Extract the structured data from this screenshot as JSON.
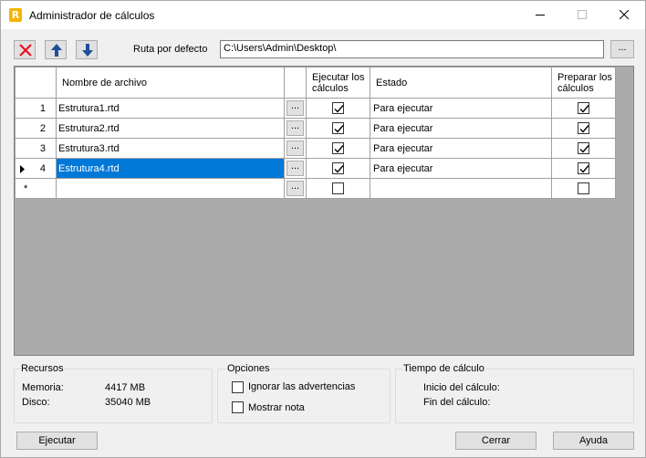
{
  "window": {
    "title": "Administrador de cálculos",
    "icon_letter": "R"
  },
  "toolbar": {
    "path_label": "Ruta por defecto",
    "path_value": "C:\\Users\\Admin\\Desktop\\",
    "browse_label": "..."
  },
  "grid": {
    "columns": {
      "name": "Nombre de archivo",
      "run": "Ejecutar los cálculos",
      "state": "Estado",
      "prepare": "Preparar los cálculos"
    },
    "rows": [
      {
        "num": "1",
        "file": "Estrutura1.rtd",
        "dots": "...",
        "run": true,
        "state": "Para ejecutar",
        "prepare": true,
        "selected": false
      },
      {
        "num": "2",
        "file": "Estrutura2.rtd",
        "dots": "...",
        "run": true,
        "state": "Para ejecutar",
        "prepare": true,
        "selected": false
      },
      {
        "num": "3",
        "file": "Estrutura3.rtd",
        "dots": "...",
        "run": true,
        "state": "Para ejecutar",
        "prepare": true,
        "selected": false
      },
      {
        "num": "4",
        "file": "Estrutura4.rtd",
        "dots": "...",
        "run": true,
        "state": "Para ejecutar",
        "prepare": true,
        "selected": true
      }
    ],
    "new_row": {
      "marker": "*",
      "dots": "..."
    }
  },
  "resources": {
    "title": "Recursos",
    "memory_label": "Memoria:",
    "memory_value": "4417 MB",
    "disk_label": "Disco:",
    "disk_value": "35040 MB"
  },
  "options": {
    "title": "Opciones",
    "ignore_warnings": "Ignorar las advertencias",
    "ignore_checked": false,
    "show_note": "Mostrar nota",
    "show_note_checked": false
  },
  "timing": {
    "title": "Tiempo de cálculo",
    "start_label": "Inicio del cálculo:",
    "end_label": "Fin del cálculo:"
  },
  "buttons": {
    "run": "Ejecutar",
    "close": "Cerrar",
    "help": "Ayuda"
  },
  "colors": {
    "selection": "#0078d7",
    "delete": "#e81123",
    "arrows": "#1f4e9a",
    "app_icon": "#f4b400"
  }
}
